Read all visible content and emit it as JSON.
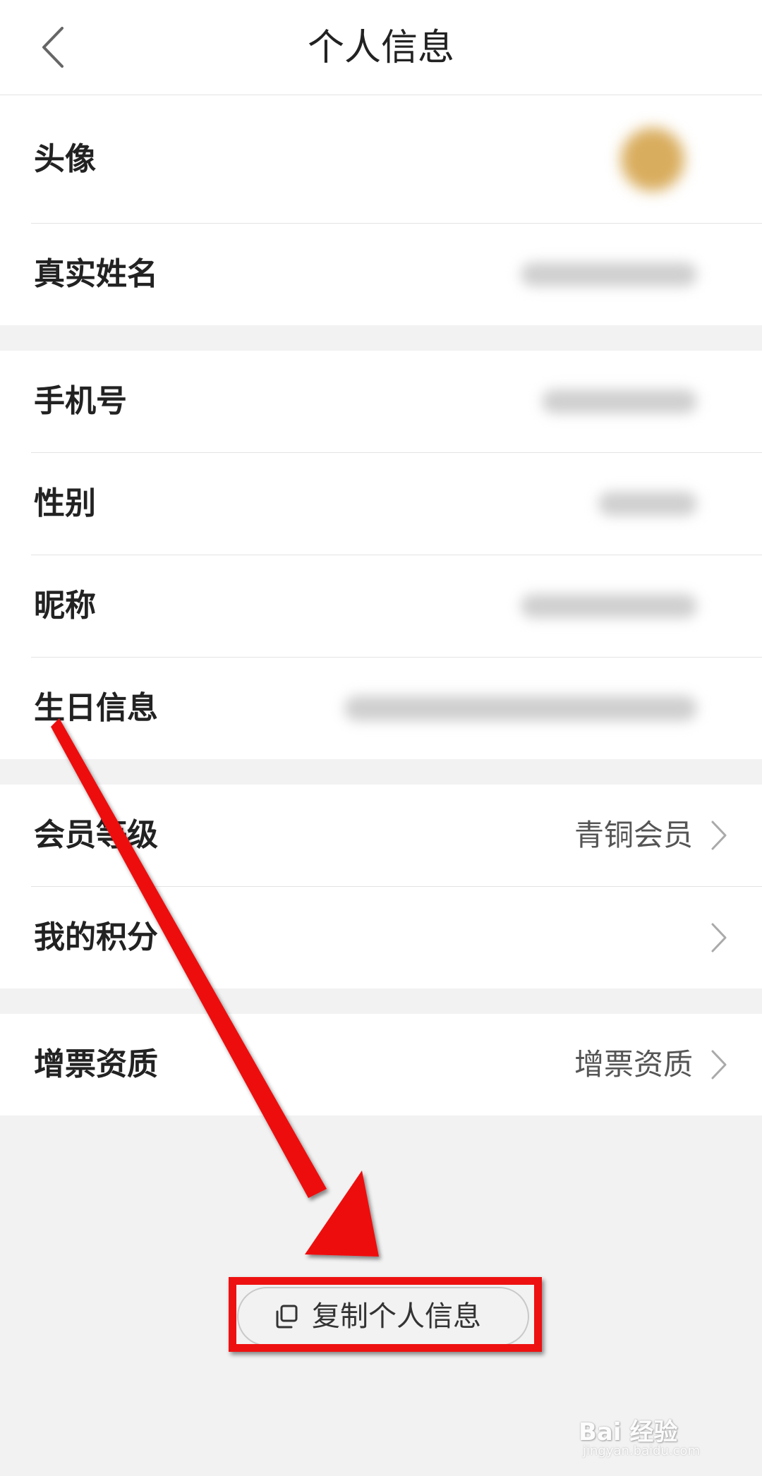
{
  "header": {
    "title": "个人信息"
  },
  "groups": [
    {
      "rows": [
        {
          "label": "头像",
          "value": ""
        },
        {
          "label": "真实姓名",
          "value": ""
        }
      ]
    },
    {
      "rows": [
        {
          "label": "手机号",
          "value": ""
        },
        {
          "label": "性别",
          "value": ""
        },
        {
          "label": "昵称",
          "value": ""
        },
        {
          "label": "生日信息",
          "value": ""
        }
      ]
    },
    {
      "rows": [
        {
          "label": "会员等级",
          "value": "青铜会员"
        },
        {
          "label": "我的积分",
          "value": ""
        }
      ]
    },
    {
      "rows": [
        {
          "label": "增票资质",
          "value": "增票资质"
        }
      ]
    }
  ],
  "copy_button": {
    "label": "复制个人信息"
  },
  "annotation": {
    "highlight_color": "#ee1111"
  },
  "watermark": {
    "logo": "Bai 经验",
    "url": "jingyan.baidu.com"
  },
  "colors": {
    "page_background": "#f2f2f2",
    "card_background": "#ffffff",
    "divider": "#e3e3e3",
    "avatar": "#d9ad5e"
  }
}
